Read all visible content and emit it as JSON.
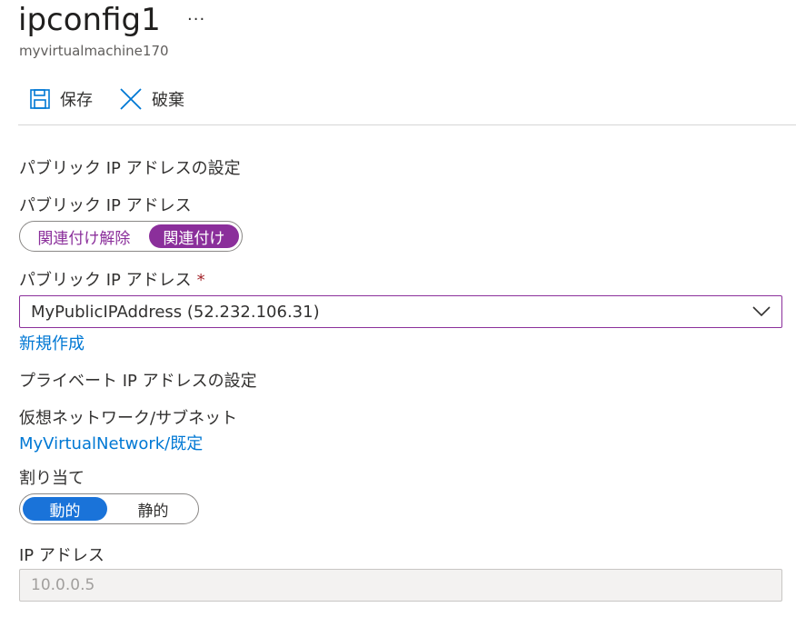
{
  "header": {
    "title": "ipconfig1",
    "more": "...",
    "subtitle": "myvirtualmachine170"
  },
  "toolbar": {
    "save_label": "保存",
    "discard_label": "破棄"
  },
  "public_ip": {
    "section_title": "パブリック IP アドレスの設定",
    "toggle_label": "パブリック IP アドレス",
    "toggle_options": [
      "関連付け解除",
      "関連付け"
    ],
    "selected_option": "関連付け",
    "select_label": "パブリック IP アドレス",
    "required_mark": "*",
    "select_value": "MyPublicIPAddress (52.232.106.31)",
    "create_new": "新規作成"
  },
  "private_ip": {
    "section_title": "プライベート IP アドレスの設定",
    "vnet_label": "仮想ネットワーク/サブネット",
    "vnet_link": "MyVirtualNetwork/既定",
    "assignment_label": "割り当て",
    "assignment_options": [
      "動的",
      "静的"
    ],
    "selected_assignment": "動的",
    "ip_label": "IP アドレス",
    "ip_value": "10.0.0.5"
  },
  "colors": {
    "accent_purple": "#8b2f9b",
    "accent_blue": "#1a73d9",
    "link": "#0078d4",
    "required": "#a4262c"
  },
  "icons": {
    "save": "save-icon",
    "discard": "close-icon",
    "select": "chevron-down-icon"
  }
}
